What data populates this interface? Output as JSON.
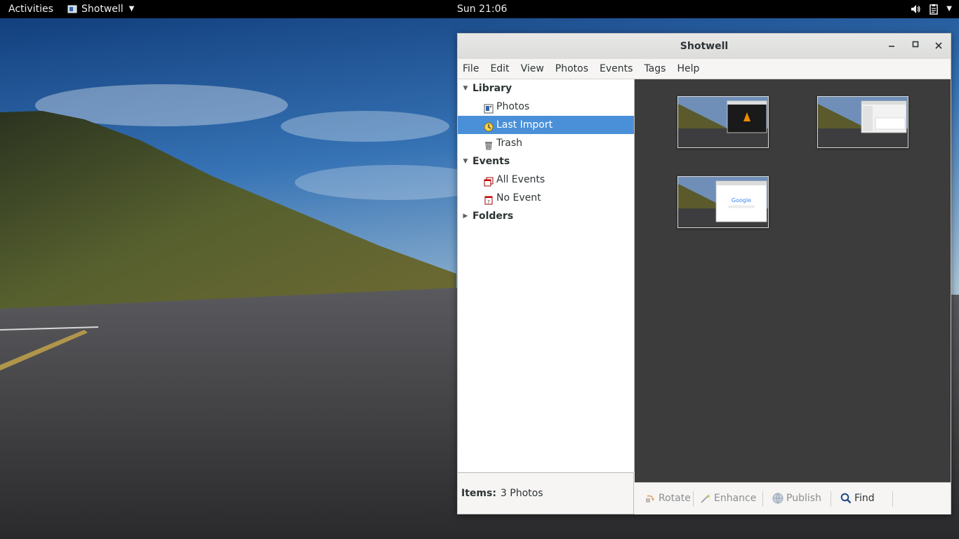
{
  "topbar": {
    "activities": "Activities",
    "app_name": "Shotwell",
    "clock": "Sun 21:06",
    "icons": [
      "volume-icon",
      "clipboard-icon",
      "system-menu-chevron-icon"
    ]
  },
  "window": {
    "title": "Shotwell",
    "controls": [
      "minimize-icon",
      "maximize-icon",
      "close-icon"
    ]
  },
  "menubar": [
    "File",
    "Edit",
    "View",
    "Photos",
    "Events",
    "Tags",
    "Help"
  ],
  "sidebar": {
    "library": {
      "label": "Library",
      "items": [
        {
          "label": "Photos",
          "icon": "photos-icon"
        },
        {
          "label": "Last Import",
          "icon": "last-import-icon",
          "selected": true
        },
        {
          "label": "Trash",
          "icon": "trash-icon"
        }
      ]
    },
    "events": {
      "label": "Events",
      "items": [
        {
          "label": "All Events",
          "icon": "all-events-icon"
        },
        {
          "label": "No Event",
          "icon": "no-event-icon"
        }
      ]
    },
    "folders": {
      "label": "Folders"
    }
  },
  "status": {
    "label": "Items:",
    "value": "3 Photos"
  },
  "thumbnails": [
    {
      "name": "screenshot-vlc",
      "icon": "vlc-cone-icon"
    },
    {
      "name": "screenshot-dialog"
    },
    {
      "name": "screenshot-google",
      "text": "Google"
    }
  ],
  "toolbar": {
    "rotate": "Rotate",
    "enhance": "Enhance",
    "publish": "Publish",
    "find": "Find"
  },
  "colors": {
    "selection": "#4a90d9",
    "content_bg": "#3c3c3c",
    "topbar_bg": "#000000"
  }
}
